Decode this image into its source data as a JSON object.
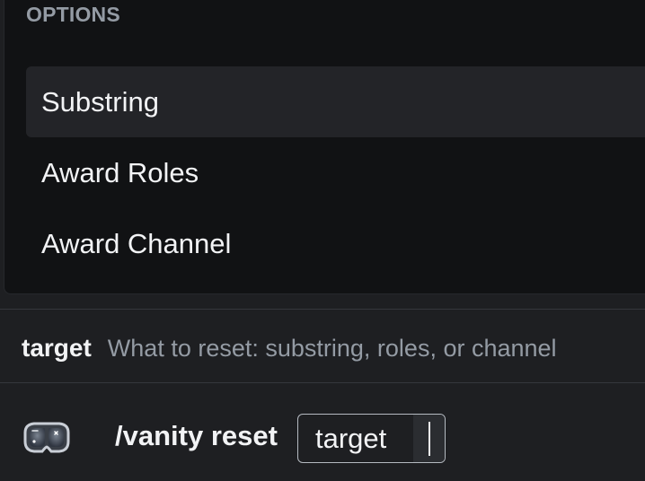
{
  "options_panel": {
    "header": "OPTIONS",
    "items": [
      {
        "label": "Substring",
        "selected": true
      },
      {
        "label": "Award Roles",
        "selected": false
      },
      {
        "label": "Award Channel",
        "selected": false
      }
    ]
  },
  "parameter": {
    "name": "target",
    "description": "What to reset: substring, roles, or channel"
  },
  "command": {
    "bot_avatar_icon": "diving-mask-icon",
    "text": "/vanity reset",
    "option_chip_label": "target",
    "option_chip_value": ""
  },
  "colors": {
    "background": "#1e1f22",
    "panel": "#111214",
    "selected_row": "#232428",
    "muted_text": "#949ba4",
    "primary_text": "#f2f3f5"
  }
}
